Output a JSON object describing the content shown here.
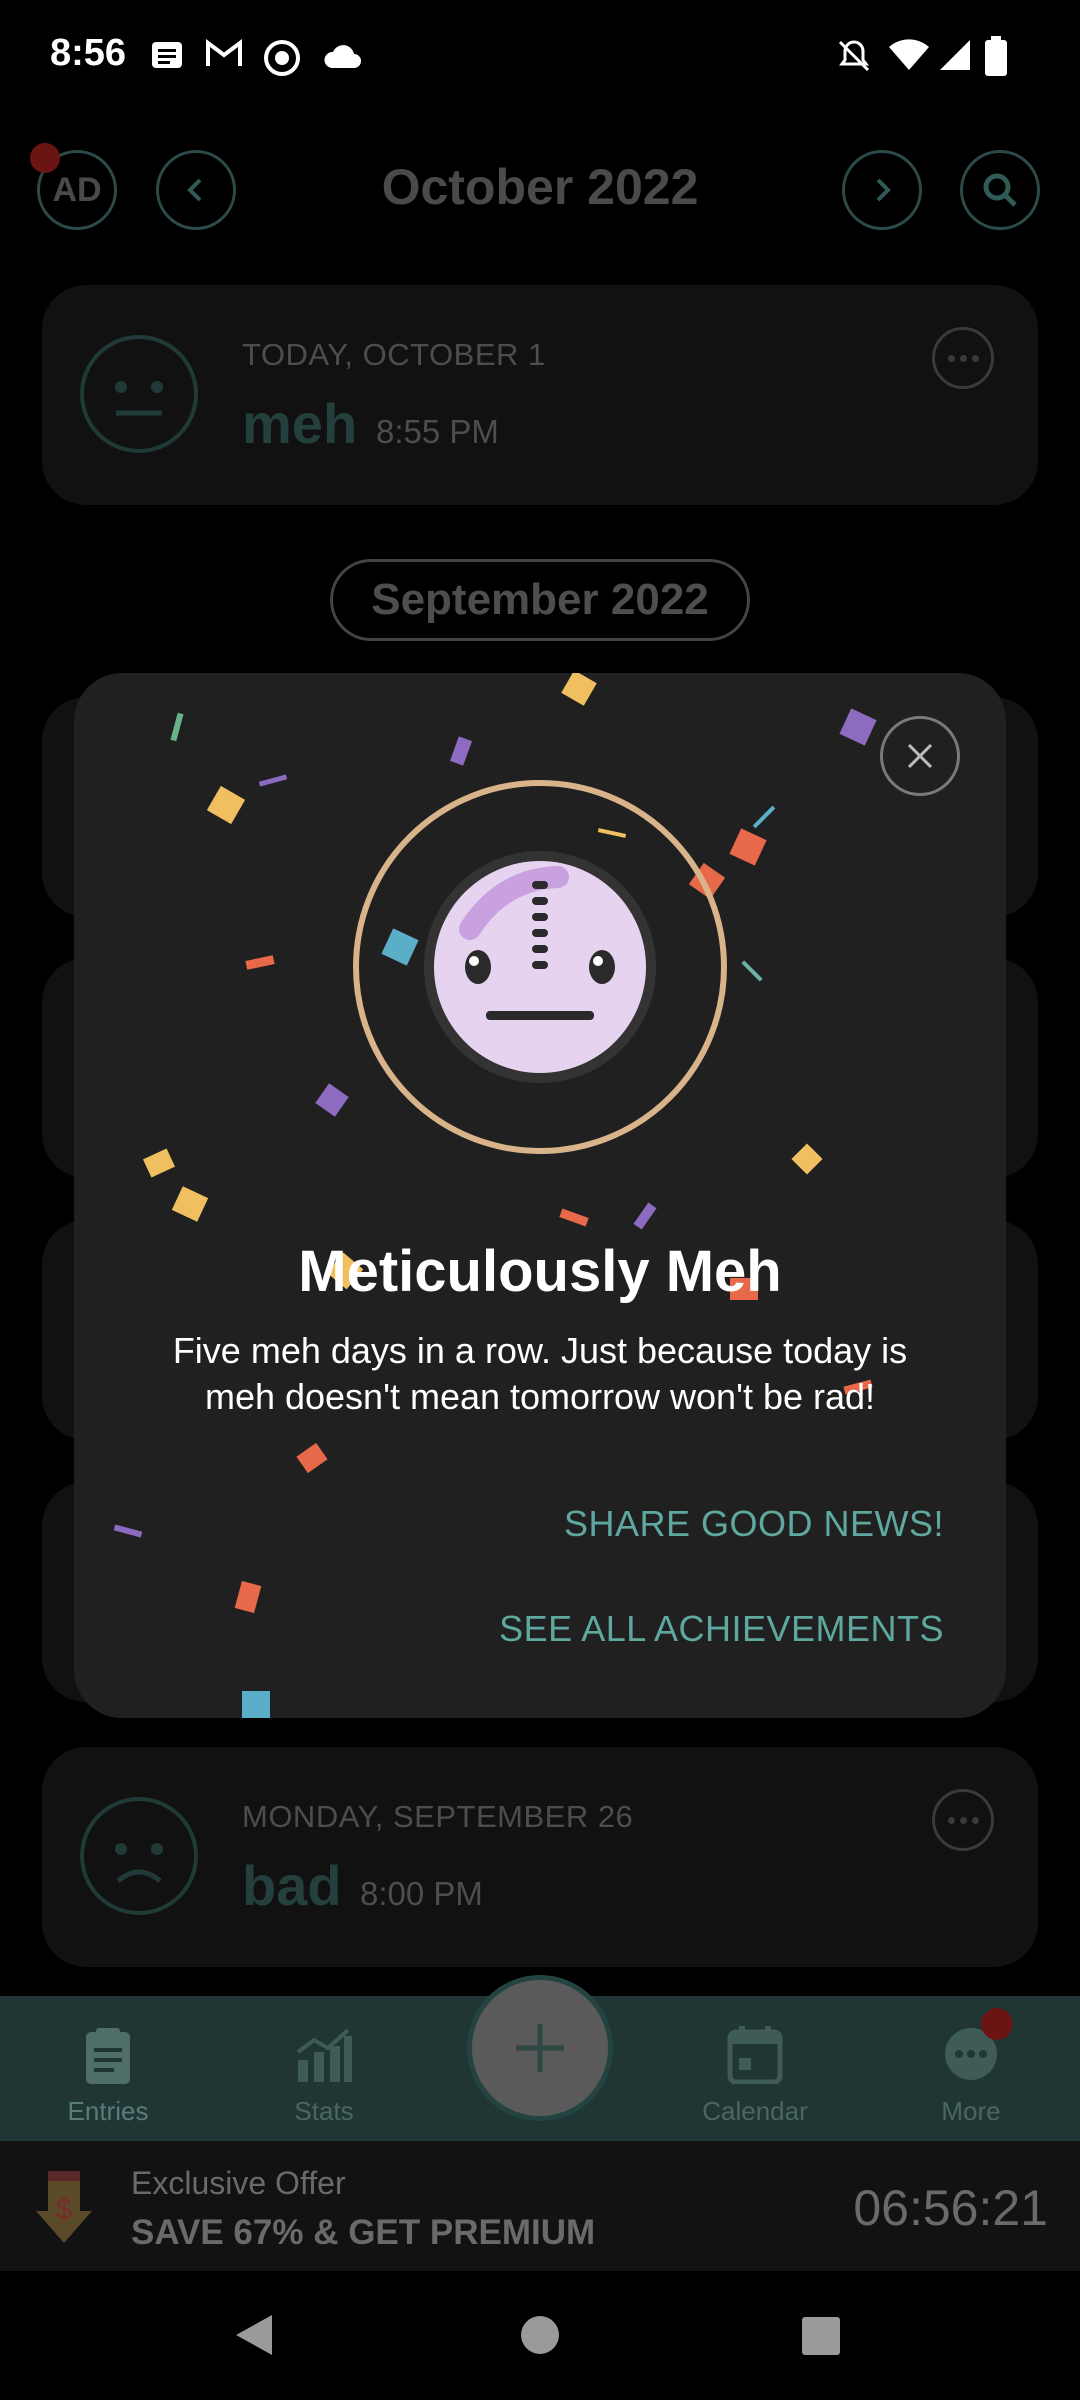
{
  "status_bar": {
    "time": "8:56"
  },
  "header": {
    "month": "October 2022",
    "ad_label": "AD"
  },
  "entries": [
    {
      "date": "TODAY, OCTOBER 1",
      "mood": "meh",
      "time": "8:55 PM"
    },
    {
      "date": "MONDAY, SEPTEMBER 26",
      "mood": "bad",
      "time": "8:00 PM"
    }
  ],
  "section_pill": "September 2022",
  "achievement": {
    "title": "Meticulously Meh",
    "description": "Five meh days in a row. Just because today is meh doesn't mean tomorrow won't be rad!",
    "share_label": "SHARE GOOD NEWS!",
    "see_all_label": "SEE ALL ACHIEVEMENTS"
  },
  "nav": {
    "items": [
      {
        "label": "Entries",
        "icon": "entries-icon"
      },
      {
        "label": "Stats",
        "icon": "stats-icon"
      },
      {
        "label": "Calendar",
        "icon": "calendar-icon"
      },
      {
        "label": "More",
        "icon": "more-icon"
      }
    ]
  },
  "offer": {
    "line1": "Exclusive Offer",
    "line2": "SAVE 67% & GET PREMIUM",
    "countdown": "06:56:21"
  },
  "colors": {
    "accent": "#5fa8a0",
    "modal_bg": "#202020",
    "nav_bg": "#1f3635",
    "face_fill": "#e6d3ef",
    "ring": "#d9b48a"
  }
}
